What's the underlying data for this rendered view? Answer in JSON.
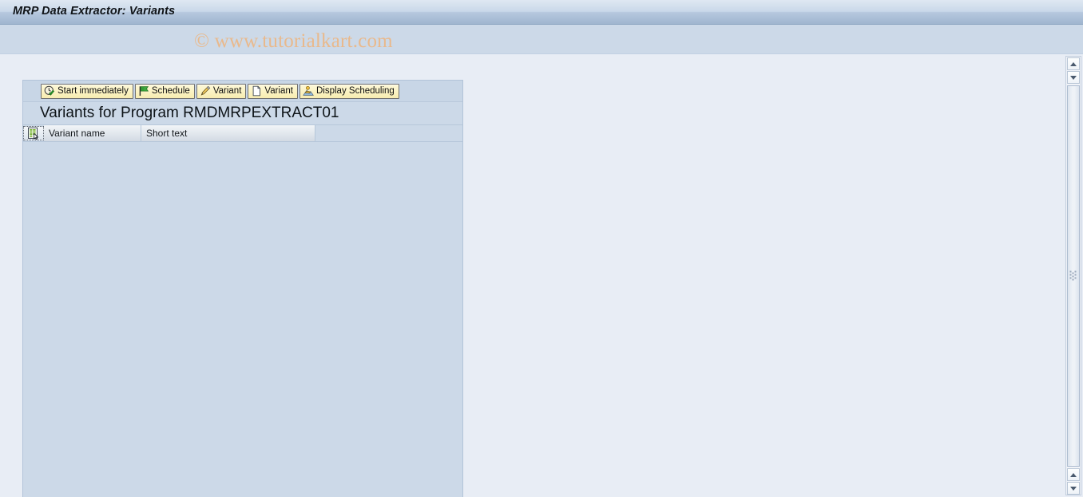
{
  "window": {
    "title": "MRP Data Extractor: Variants"
  },
  "watermark": {
    "text": "© www.tutorialkart.com"
  },
  "toolbar": {
    "buttons": [
      {
        "label": "Start immediately",
        "icon": "clock-check-icon"
      },
      {
        "label": "Schedule",
        "icon": "flag-icon"
      },
      {
        "label": "Variant",
        "icon": "pencil-icon"
      },
      {
        "label": "Variant",
        "icon": "blank-page-icon"
      },
      {
        "label": "Display Scheduling",
        "icon": "scheduling-person-icon"
      }
    ]
  },
  "panel": {
    "title": "Variants for Program RMDMRPEXTRACT01"
  },
  "table": {
    "select_all_icon": "select-all-icon",
    "columns": [
      {
        "label": "Variant name"
      },
      {
        "label": "Short text"
      }
    ],
    "rows": []
  },
  "scrollbar": {
    "up_label": "▲",
    "down_label": "▼"
  },
  "colors": {
    "titlebar_start": "#dfe8f2",
    "titlebar_end": "#9fb5cf",
    "panel_bg": "#ccd9e8",
    "workarea_bg": "#e8edf5",
    "button_face": "#fbf3c4",
    "watermark": "#e9b98c",
    "header_grad_top": "#f2f5f8"
  }
}
